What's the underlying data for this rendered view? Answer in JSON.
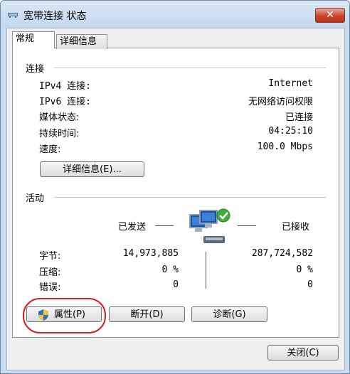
{
  "window": {
    "title": "宽带连接 状态",
    "close_label": "✕"
  },
  "tabs": [
    {
      "label": "常规"
    },
    {
      "label": "详细信息"
    }
  ],
  "connection": {
    "title": "连接",
    "rows": [
      {
        "label": "IPv4 连接:",
        "value": "Internet"
      },
      {
        "label": "IPv6 连接:",
        "value": "无网络访问权限"
      },
      {
        "label": "媒体状态:",
        "value": "已连接"
      },
      {
        "label": "持续时间:",
        "value": "04:25:10"
      },
      {
        "label": "速度:",
        "value": "100.0 Mbps"
      }
    ],
    "details_button": "详细信息(E)..."
  },
  "activity": {
    "title": "活动",
    "sent_label": "已发送",
    "received_label": "已接收",
    "rows": [
      {
        "label": "字节:",
        "sent": "14,973,885",
        "received": "287,724,582"
      },
      {
        "label": "压缩:",
        "sent": "0 %",
        "received": "0 %"
      },
      {
        "label": "错误:",
        "sent": "0",
        "received": "0"
      }
    ]
  },
  "buttons": {
    "properties": "属性(P)",
    "disconnect": "断开(D)",
    "diagnose": "诊断(G)"
  },
  "footer": {
    "close": "关闭(C)"
  },
  "colors": {
    "titlebar": "#c9dcef",
    "close_button": "#c8452b",
    "highlight": "#d52020"
  }
}
